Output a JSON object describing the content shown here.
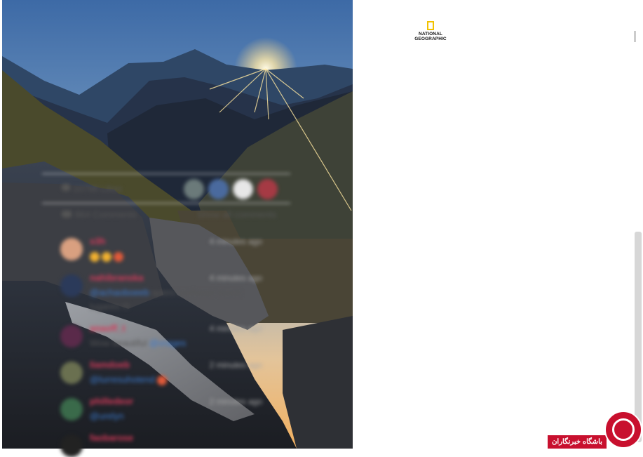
{
  "post": {
    "brand_logo_text": "NATIONAL GEOGRAPHIC",
    "likes_text": "10798 Likes",
    "comments_count_text": "864 Comments",
    "show_all_comments": "Show all comments"
  },
  "comments": [
    {
      "user": "s3h",
      "time": "4 minutes ago",
      "body": "",
      "mention": "",
      "emoji_count": 3
    },
    {
      "user": "nahibranska",
      "time": "4 minutes ago",
      "mention": "@achaoboeeb",
      "body": "quero conhecer esses lugares !!!",
      "emoji_count": 0
    },
    {
      "user": "anaoff_t",
      "time": "4 minutes ago",
      "body": "Wow beautiful",
      "mention": "@vrages",
      "emoji_count": 0
    },
    {
      "user": "liamdoeb",
      "time": "2 minutes ago",
      "body": "",
      "mention": "@lurresuhotend",
      "emoji_count": 1
    },
    {
      "user": "philledeor",
      "time": "2 minutes ago",
      "body": "",
      "mention": "@urelyn",
      "emoji_count": 0
    },
    {
      "user": "faobarose",
      "time": "",
      "body": "",
      "mention": "",
      "emoji_count": 0
    }
  ],
  "watermark": {
    "label": "باشگاه خبرنگاران"
  },
  "colors": {
    "username": "#d63a5a",
    "mention": "#3b7bd0",
    "brand_yellow": "#f2c200",
    "watermark_red": "#c8102e"
  }
}
